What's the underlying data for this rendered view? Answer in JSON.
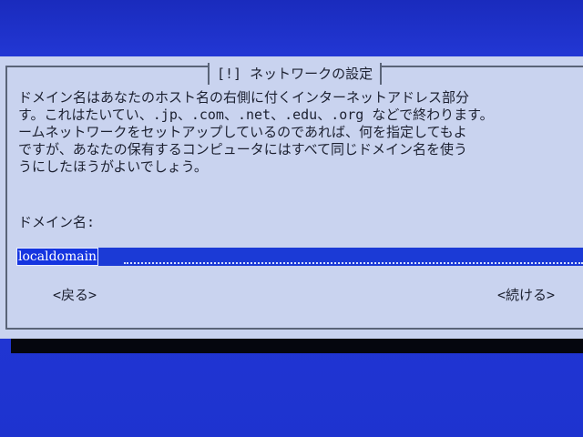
{
  "dialog": {
    "title": "[!] ネットワークの設定",
    "description_lines": [
      "ドメイン名はあなたのホスト名の右側に付くインターネットアドレス部分",
      "す。これはたいてい、.jp、.com、.net、.edu、.org などで終わります。",
      "ームネットワークをセットアップしているのであれば、何を指定してもよ",
      "ですが、あなたの保有するコンピュータにはすべて同じドメイン名を使う",
      "うにしたほうがよいでしょう。"
    ],
    "field_label": "ドメイン名:",
    "input_value": "localdomain",
    "back_button": "<戻る>",
    "continue_button": "<続ける>"
  },
  "colors": {
    "screen_background": "#1e33cf",
    "dialog_background": "#c9d3ef",
    "input_highlight": "#1535e0",
    "text": "#1c2030"
  }
}
